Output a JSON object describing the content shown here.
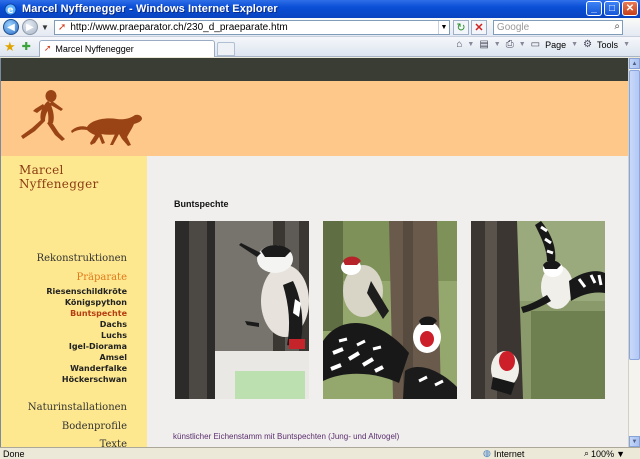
{
  "window": {
    "title": "Marcel Nyffenegger - Windows Internet Explorer",
    "buttons": {
      "minimize": "_",
      "maximize": "□",
      "close": "✕"
    }
  },
  "address": {
    "url": "http://www.praeparator.ch/230_d_praeparate.htm",
    "search_placeholder": "Google"
  },
  "tabs": [
    {
      "label": "Marcel Nyffenegger"
    }
  ],
  "commands": {
    "page": "Page",
    "tools": "Tools"
  },
  "site": {
    "name": "Marcel Nyffenegger",
    "nav": {
      "reconstructions": "Rekonstruktionen",
      "preparations": "Präparate",
      "sub": [
        "Riesenschildkröte",
        "Königspython",
        "Buntspechte",
        "Dachs",
        "Luchs",
        "Igel-Diorama",
        "Amsel",
        "Wanderfalke",
        "Höckerschwan"
      ],
      "active_sub": "Buntspechte",
      "nature": "Naturinstallationen",
      "soil": "Bodenprofile",
      "cut_off": "Texte"
    }
  },
  "content": {
    "title": "Buntspechte",
    "caption": "künstlicher Eichenstamm mit Buntspechten (Jung- und Altvogel)"
  },
  "status": {
    "left": "Done",
    "zone": "Internet",
    "zoom": "100%"
  },
  "colors": {
    "banner": "#fdc88a",
    "sidebar": "#fde88f",
    "brand": "#8b3b12",
    "nav_active": "#e27a1b",
    "sub_active": "#b53d12"
  }
}
